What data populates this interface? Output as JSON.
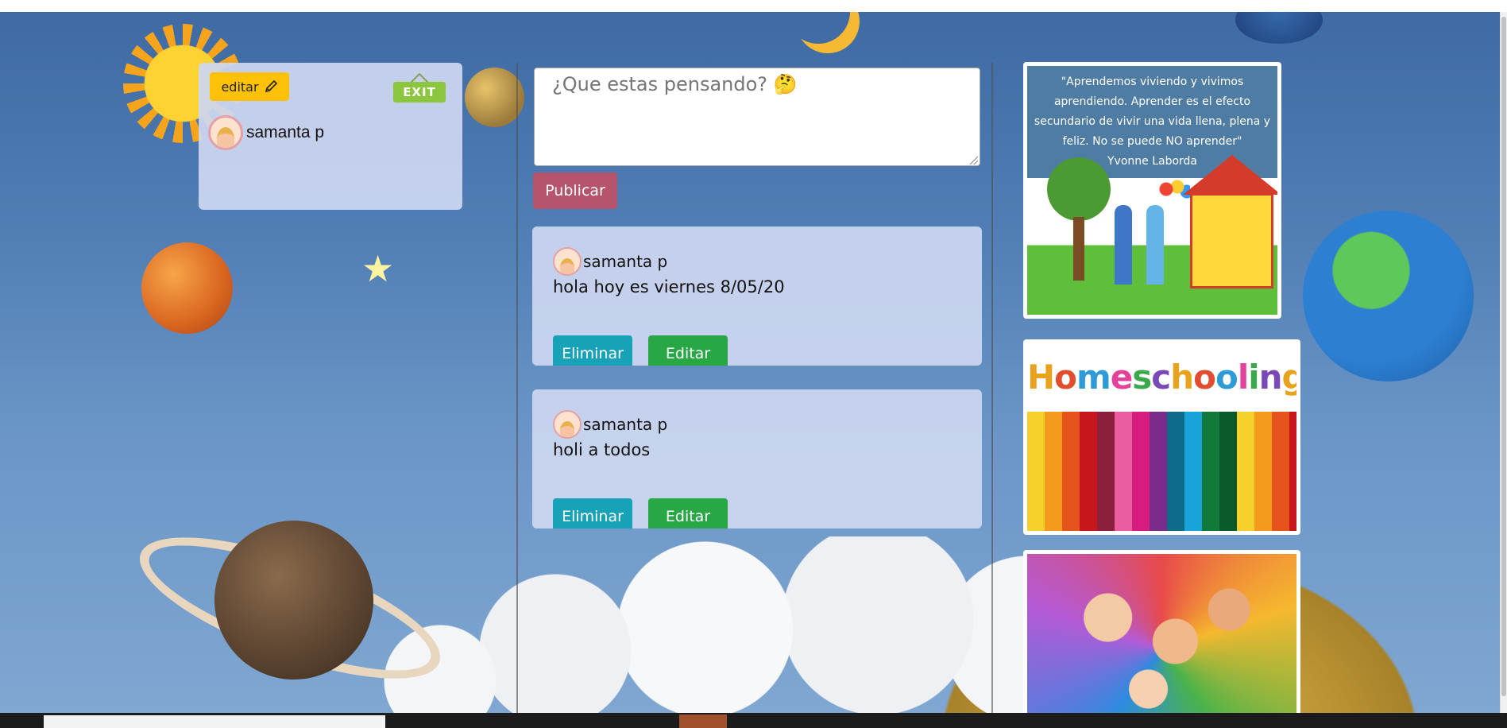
{
  "profile": {
    "edit_label": "editar",
    "exit_label": "EXIT",
    "user_name": "samanta p"
  },
  "composer": {
    "placeholder": "¿Que estas pensando? 🤔",
    "publish_label": "Publicar"
  },
  "posts": [
    {
      "author": "samanta p",
      "text": "hola hoy es viernes 8/05/20",
      "delete_label": "Eliminar",
      "edit_label": "Editar"
    },
    {
      "author": "samanta p",
      "text": "holi a todos",
      "delete_label": "Eliminar",
      "edit_label": "Editar"
    }
  ],
  "sidebar_images": {
    "quote": "\"Aprendemos viviendo y vivimos aprendiendo. Aprender es el efecto secundario de vivir una vida llena, plena y feliz. No se puede NO aprender\"",
    "quote_author": "Yvonne Laborda",
    "homeschooling_title": "Homeschooling"
  },
  "colors": {
    "profile_panel": "#cdd7f0",
    "edit_button": "#ffc107",
    "exit_sign": "#8cc63f",
    "publish_button": "#b5546c",
    "delete_button": "#17a2b8",
    "edit_post_button": "#28a745"
  },
  "icons": {
    "edit": "pencil-icon",
    "avatar": "avatar-icon",
    "thinking_emoji": "thinking-face-emoji"
  }
}
